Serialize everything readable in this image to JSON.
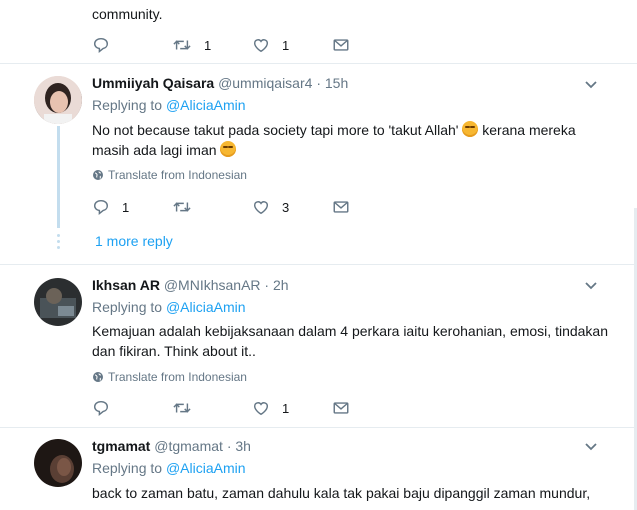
{
  "tweet0": {
    "text": "community.",
    "actions": {
      "reply_count": "",
      "retweet_count": "1",
      "like_count": "1"
    }
  },
  "tweet1": {
    "name": "Ummiiyah Qaisara",
    "handle": "@ummiqaisar4",
    "time": "15h",
    "replying_prefix": "Replying to",
    "replying_to": "@AliciaAmin",
    "line1_a": "No not because takut pada society tapi more to 'takut Allah'",
    "line1_b": "kerana mereka",
    "line2": "masih ada lagi iman",
    "translate": "Translate from Indonesian",
    "actions": {
      "reply_count": "1",
      "retweet_count": "",
      "like_count": "3"
    },
    "more_replies": "1 more reply"
  },
  "tweet2": {
    "name": "Ikhsan AR",
    "handle": "@MNIkhsanAR",
    "time": "2h",
    "replying_prefix": "Replying to",
    "replying_to": "@AliciaAmin",
    "line1": "Kemajuan adalah kebijaksanaan dalam 4 perkara iaitu kerohanian, emosi, tindakan",
    "line2": "dan fikiran. Think about it..",
    "translate": "Translate from Indonesian",
    "actions": {
      "reply_count": "",
      "retweet_count": "",
      "like_count": "1"
    }
  },
  "tweet3": {
    "name": "tgmamat",
    "handle": "@tgmamat",
    "time": "3h",
    "replying_prefix": "Replying to",
    "replying_to": "@AliciaAmin",
    "line1": "back to zaman batu, zaman dahulu kala tak pakai baju dipanggil zaman mundur,"
  }
}
